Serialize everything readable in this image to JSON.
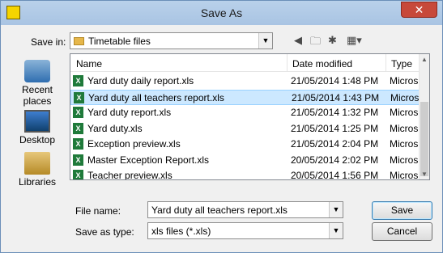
{
  "window": {
    "title": "Save As",
    "close_glyph": "✕"
  },
  "save_in": {
    "label": "Save in:",
    "value": "Timetable files"
  },
  "toolbar": {
    "back_icon": "back-arrow-icon",
    "up_icon": "folder-up-icon",
    "new_folder_icon": "new-folder-icon",
    "view_icon": "view-menu-icon"
  },
  "places": [
    {
      "label": "Recent places"
    },
    {
      "label": "Desktop"
    },
    {
      "label": "Libraries"
    }
  ],
  "columns": {
    "name": "Name",
    "date": "Date modified",
    "type": "Type"
  },
  "files": [
    {
      "name": "Yard duty daily report.xls",
      "date": "21/05/2014 1:48 PM",
      "type": "Micros"
    },
    {
      "name": "Yard duty all teachers report.xls",
      "date": "21/05/2014 1:43 PM",
      "type": "Micros"
    },
    {
      "name": "Yard duty report.xls",
      "date": "21/05/2014 1:32 PM",
      "type": "Micros"
    },
    {
      "name": "Yard duty.xls",
      "date": "21/05/2014 1:25 PM",
      "type": "Micros"
    },
    {
      "name": "Exception preview.xls",
      "date": "21/05/2014 2:04 PM",
      "type": "Micros"
    },
    {
      "name": "Master Exception Report.xls",
      "date": "20/05/2014 2:02 PM",
      "type": "Micros"
    },
    {
      "name": "Teacher preview.xls",
      "date": "20/05/2014 1:56 PM",
      "type": "Micros"
    }
  ],
  "selected_index": 1,
  "file_name": {
    "label": "File name:",
    "value": "Yard duty all teachers report.xls"
  },
  "save_as_type": {
    "label": "Save as type:",
    "value": "xls files (*.xls)"
  },
  "buttons": {
    "save": "Save",
    "cancel": "Cancel"
  },
  "colors": {
    "selection": "#cce8ff",
    "excel_green": "#1f7a3a",
    "close_red": "#c7493a"
  }
}
